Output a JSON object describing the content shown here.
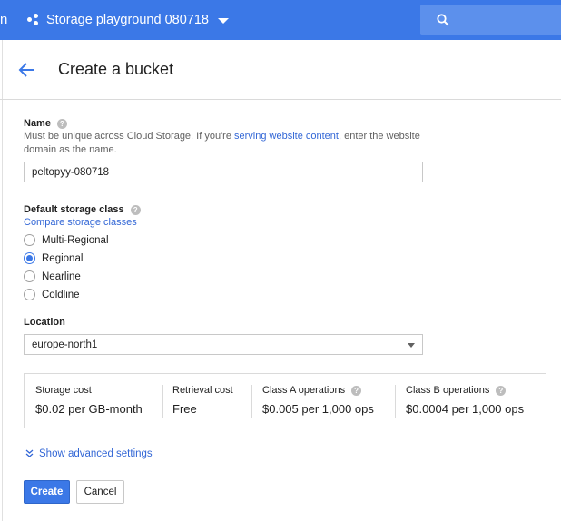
{
  "topbar": {
    "edge_char": "n",
    "project_name": "Storage playground 080718",
    "accent": "#3b78e7"
  },
  "header": {
    "title": "Create a bucket"
  },
  "name_section": {
    "label": "Name",
    "desc_before": "Must be unique across Cloud Storage. If you're ",
    "desc_link": "serving website content",
    "desc_after": ", enter the website domain as the name.",
    "value": "peltopyy-080718"
  },
  "storage_class": {
    "label": "Default storage class",
    "compare_link": "Compare storage classes",
    "options": [
      {
        "label": "Multi-Regional",
        "checked": false
      },
      {
        "label": "Regional",
        "checked": true
      },
      {
        "label": "Nearline",
        "checked": false
      },
      {
        "label": "Coldline",
        "checked": false
      }
    ]
  },
  "location": {
    "label": "Location",
    "value": "europe-north1"
  },
  "costs": [
    {
      "header": "Storage cost",
      "value": "$0.02 per GB-month",
      "help": false
    },
    {
      "header": "Retrieval cost",
      "value": "Free",
      "help": false
    },
    {
      "header": "Class A operations",
      "value": "$0.005 per 1,000 ops",
      "help": true
    },
    {
      "header": "Class B operations",
      "value": "$0.0004 per 1,000 ops",
      "help": true
    }
  ],
  "advanced_label": "Show advanced settings",
  "buttons": {
    "create": "Create",
    "cancel": "Cancel"
  },
  "help_glyph": "?"
}
